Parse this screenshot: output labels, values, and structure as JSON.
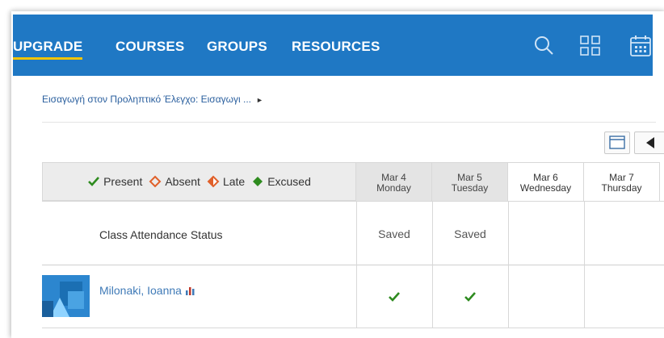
{
  "nav": {
    "items": [
      {
        "label": "UPGRADE",
        "active": true
      },
      {
        "label": "COURSES",
        "active": false
      },
      {
        "label": "GROUPS",
        "active": false
      },
      {
        "label": "RESOURCES",
        "active": false
      }
    ],
    "icons": [
      "search-icon",
      "apps-grid-icon",
      "calendar-icon"
    ],
    "color": "#1f78c4",
    "accent": "#f5c400"
  },
  "breadcrumb": {
    "text": "Εισαγωγή στον Προληπτικό Έλεγχο: Εισαγωγι ...",
    "arrow": "►"
  },
  "toolbar": {
    "icons": [
      "calendar-view-icon",
      "prev-arrow-icon"
    ]
  },
  "legend": {
    "present": "Present",
    "absent": "Absent",
    "late": "Late",
    "excused": "Excused",
    "colors": {
      "present": "#2e8b1f",
      "absent": "#e0602a",
      "late": "#e0602a",
      "excused": "#2e8b1f"
    }
  },
  "dates": [
    {
      "date": "Mar 4",
      "day": "Monday",
      "state": "done"
    },
    {
      "date": "Mar 5",
      "day": "Tuesday",
      "state": "done"
    },
    {
      "date": "Mar 6",
      "day": "Wednesday",
      "state": "open"
    },
    {
      "date": "Mar 7",
      "day": "Thursday",
      "state": "open"
    }
  ],
  "status_row": {
    "label": "Class Attendance Status",
    "values": [
      "Saved",
      "Saved",
      "",
      ""
    ]
  },
  "students": [
    {
      "name": "Milonaki, Ioanna",
      "attendance": [
        "present",
        "present",
        "",
        ""
      ]
    }
  ]
}
